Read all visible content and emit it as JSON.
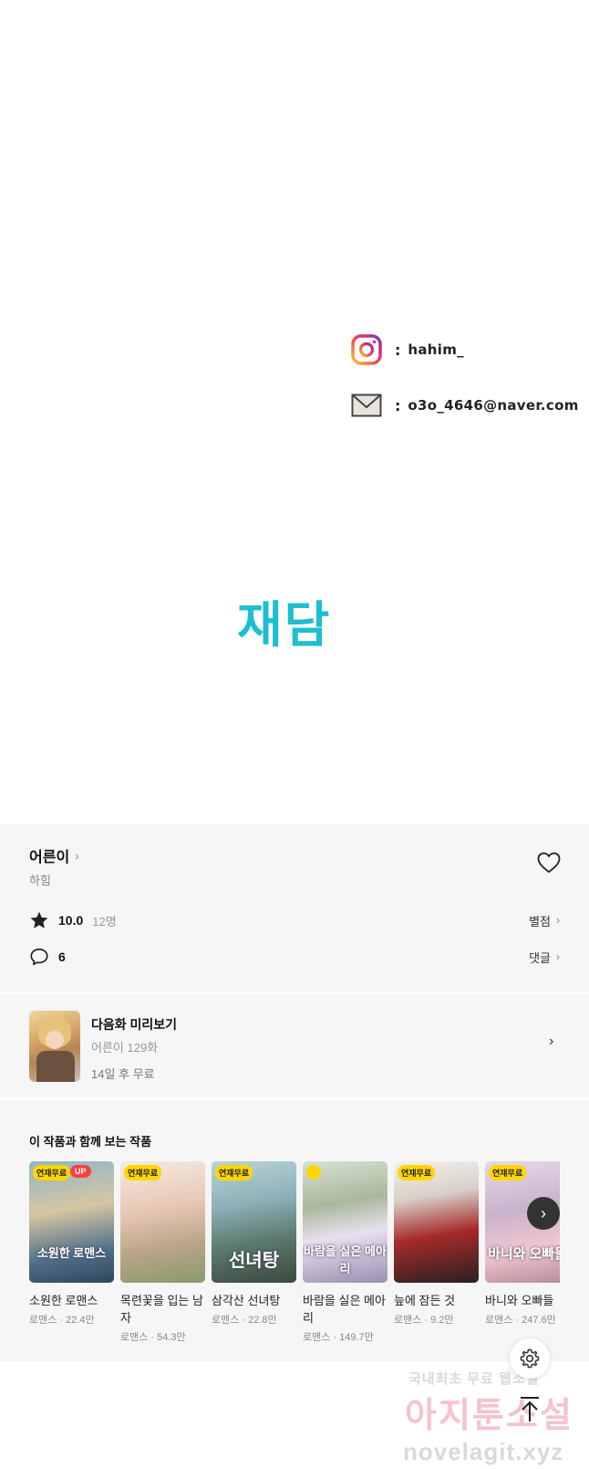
{
  "comic": {
    "instagram_colon": ":",
    "instagram_handle": "hahim_",
    "email_colon": ":",
    "email_handle": "o3o_4646@naver.com",
    "brand_logo": "재담",
    "brand_color": "#1cbfcf"
  },
  "work": {
    "title": "어른이",
    "title_chevron": "›",
    "author": "하힘",
    "favorite_icon": "heart-outline-icon"
  },
  "rating": {
    "icon": "star-icon",
    "score": "10.0",
    "count": "12명",
    "link_label": "별점",
    "link_chevron": "›"
  },
  "comments": {
    "icon": "speech-bubble-icon",
    "count": "6",
    "link_label": "댓글",
    "link_chevron": "›"
  },
  "next_episode": {
    "title": "다음화 미리보기",
    "episode": "어른이 129화",
    "free_info": "14일 후 무료",
    "chevron": "›"
  },
  "recommendations": {
    "title": "이 작품과 함께 보는 작품",
    "next_arrow": "›",
    "items": [
      {
        "badge": "연재무료",
        "badge_up": "UP",
        "cover_text": "소원한 로맨스",
        "name": "소원한 로맨스",
        "meta": "로맨스 · 22.4만"
      },
      {
        "badge": "연재무료",
        "badge_up": "",
        "cover_text": "",
        "name": "목련꽃을 입는 남자",
        "meta": "로맨스 · 54.3만"
      },
      {
        "badge": "연재무료",
        "badge_up": "",
        "cover_text": "선녀탕",
        "name": "삼각산 선녀탕",
        "meta": "로맨스 · 22.8만"
      },
      {
        "badge": "",
        "badge_up": "",
        "cover_text": "바람을 실은 메아리",
        "name": "바람을 실은 메아리",
        "meta": "로맨스 · 149.7만"
      },
      {
        "badge": "연재무료",
        "badge_up": "",
        "cover_text": "",
        "name": "늪에 잠든 것",
        "meta": "로맨스 · 9.2만"
      },
      {
        "badge": "연재무료",
        "badge_up": "",
        "cover_text": "바니와 오빠들",
        "name": "바니와 오빠들",
        "meta": "로맨스 · 247.6만"
      }
    ]
  },
  "watermark": {
    "line1": "국내최초 무료 웹소설",
    "line2": "아지툰소설",
    "line3": "novelagit.xyz"
  },
  "buttons": {
    "settings_icon": "gear-icon",
    "scroll_top_icon": "arrow-up-icon"
  }
}
